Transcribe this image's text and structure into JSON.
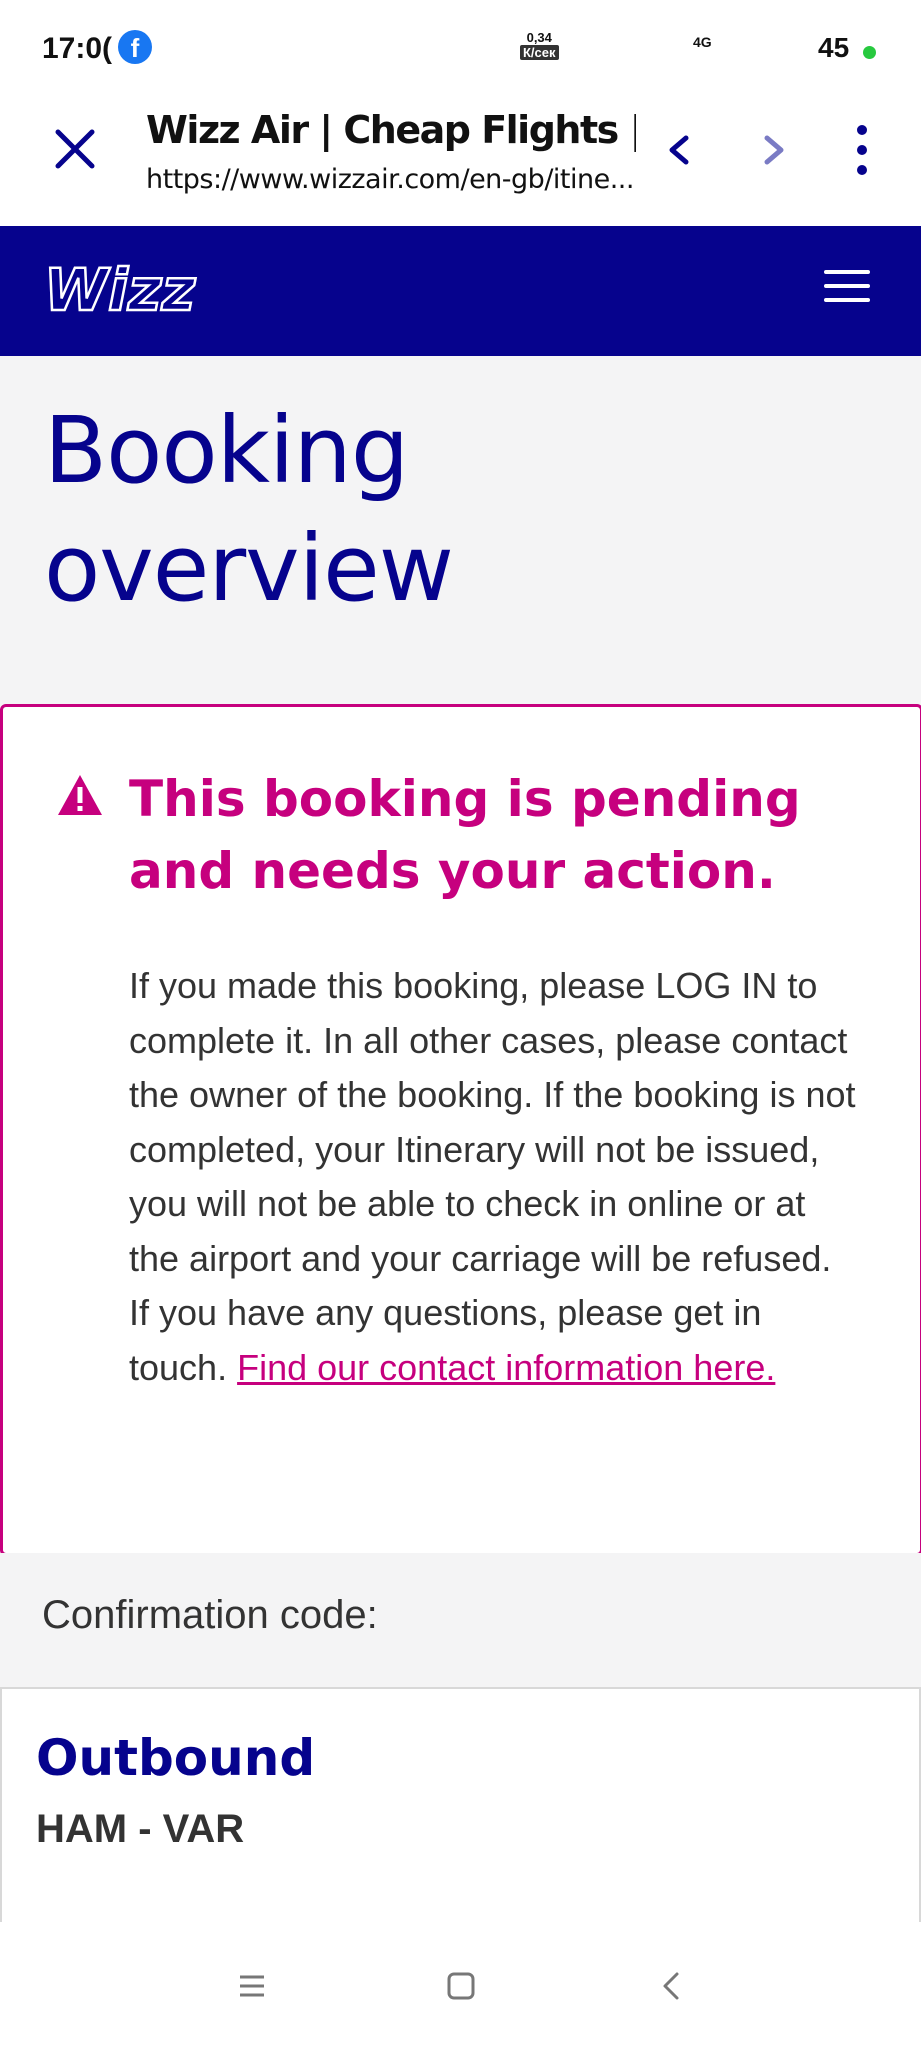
{
  "status_bar": {
    "time": "17:0(",
    "net_speed_value": "0,34",
    "net_speed_unit": "К/сек",
    "network": "4G",
    "battery": "45"
  },
  "browser": {
    "page_title": "Wizz Air | Cheap Flights | Find...",
    "url": "https://www.wizzair.com/en-gb/itine..."
  },
  "site": {
    "logo_text": "Wizz"
  },
  "main": {
    "title_line1": "Booking",
    "title_line2": "overview",
    "alert": {
      "heading": "This booking is pending and needs your action.",
      "body": "If you made this booking, please LOG IN to complete it. In all other cases, please contact the owner of the booking. If the booking is not completed, your Itinerary will not be issued, you will not be able to check in online or at the airport and your carriage will be refused. If you have any questions, please get in touch. ",
      "link_text": "Find our contact information here."
    },
    "confirmation_label": "Confirmation code:",
    "flight": {
      "direction": "Outbound",
      "route": "HAM - VAR"
    }
  },
  "colors": {
    "brand_blue": "#06038d",
    "accent_magenta": "#c6007e"
  }
}
